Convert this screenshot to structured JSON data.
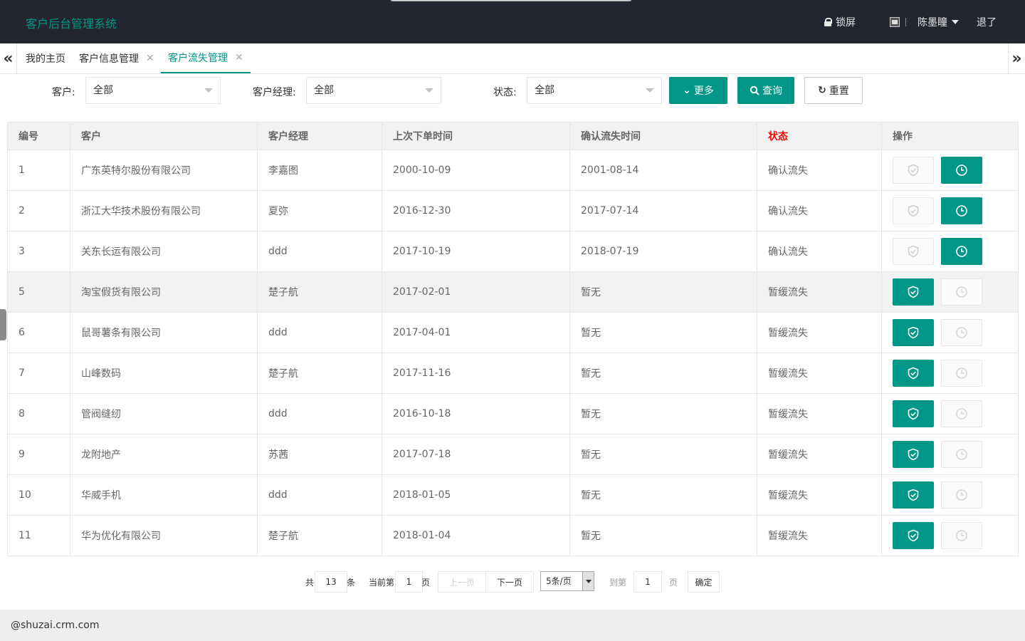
{
  "app": {
    "title": "客户后台管理系统"
  },
  "header": {
    "lock_label": "锁屏",
    "user_name": "陈墨瞳",
    "logout_label": "退了"
  },
  "tabs": [
    {
      "label": "我的主页",
      "closable": false,
      "active": false
    },
    {
      "label": "客户信息管理",
      "closable": true,
      "active": false
    },
    {
      "label": "客户流失管理",
      "closable": true,
      "active": true
    }
  ],
  "filters": {
    "customer": {
      "label": "客户:",
      "value": "全部"
    },
    "manager": {
      "label": "客户经理:",
      "value": "全部"
    },
    "status": {
      "label": "状态:",
      "value": "全部"
    },
    "more_label": "更多",
    "query_label": "查询",
    "reset_label": "重置"
  },
  "table": {
    "headers": [
      "编号",
      "客户",
      "客户经理",
      "上次下单时间",
      "确认流失时间",
      "状态",
      "操作"
    ],
    "rows": [
      {
        "id": "1",
        "customer": "广东英特尔股份有限公司",
        "manager": "李嘉图",
        "last_order": "2000-10-09",
        "confirm_time": "2001-08-14",
        "status": "确认流失"
      },
      {
        "id": "2",
        "customer": "浙江大华技术股份有限公司",
        "manager": "夏弥",
        "last_order": "2016-12-30",
        "confirm_time": "2017-07-14",
        "status": "确认流失"
      },
      {
        "id": "3",
        "customer": "关东长运有限公司",
        "manager": "ddd",
        "last_order": "2017-10-19",
        "confirm_time": "2018-07-19",
        "status": "确认流失"
      },
      {
        "id": "5",
        "customer": "淘宝假货有限公司",
        "manager": "楚子航",
        "last_order": "2017-02-01",
        "confirm_time": "暂无",
        "status": "暂缓流失"
      },
      {
        "id": "6",
        "customer": "鼠哥薯条有限公司",
        "manager": "ddd",
        "last_order": "2017-04-01",
        "confirm_time": "暂无",
        "status": "暂缓流失"
      },
      {
        "id": "7",
        "customer": "山峰数码",
        "manager": "楚子航",
        "last_order": "2017-11-16",
        "confirm_time": "暂无",
        "status": "暂缓流失"
      },
      {
        "id": "8",
        "customer": "管阀缝纫",
        "manager": "ddd",
        "last_order": "2016-10-18",
        "confirm_time": "暂无",
        "status": "暂缓流失"
      },
      {
        "id": "9",
        "customer": "龙附地产",
        "manager": "苏茜",
        "last_order": "2017-07-18",
        "confirm_time": "暂无",
        "status": "暂缓流失"
      },
      {
        "id": "10",
        "customer": "华威手机",
        "manager": "ddd",
        "last_order": "2018-01-05",
        "confirm_time": "暂无",
        "status": "暂缓流失"
      },
      {
        "id": "11",
        "customer": "华为优化有限公司",
        "manager": "楚子航",
        "last_order": "2018-01-04",
        "confirm_time": "暂无",
        "status": "暂缓流失"
      }
    ]
  },
  "pagination": {
    "total_prefix": "共",
    "total": "13",
    "total_suffix": "条",
    "current_prefix": "当前第",
    "current": "1",
    "current_suffix": "页",
    "prev_label": "上一页",
    "next_label": "下一页",
    "page_size": "5条/页",
    "goto_prefix": "到第",
    "goto_value": "1",
    "goto_suffix": "页",
    "confirm_label": "确定"
  },
  "footer": {
    "text": "@shuzai.crm.com"
  },
  "colors": {
    "accent": "#009688",
    "header_bg": "#23262e",
    "confirm_status": "#ff0000",
    "pause_status": "#ffb800"
  }
}
